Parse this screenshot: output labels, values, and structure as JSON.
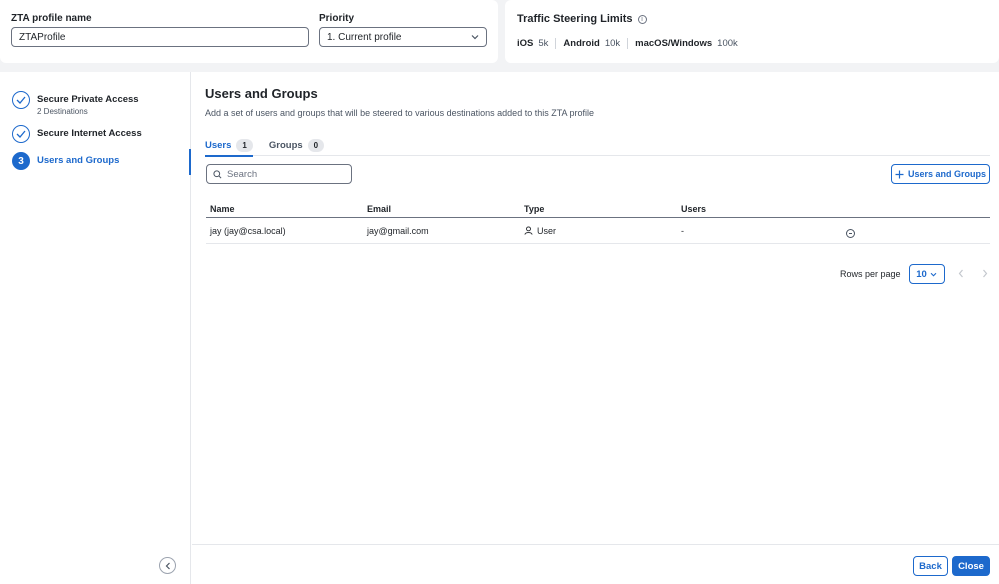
{
  "profile": {
    "name_label": "ZTA profile name",
    "name_value": "ZTAProfile",
    "priority_label": "Priority",
    "priority_value": "1. Current profile"
  },
  "traffic_limits": {
    "title": "Traffic Steering Limits",
    "items": [
      {
        "platform": "iOS",
        "value": "5k"
      },
      {
        "platform": "Android",
        "value": "10k"
      },
      {
        "platform": "macOS/Windows",
        "value": "100k"
      }
    ]
  },
  "steps": [
    {
      "title": "Secure Private Access",
      "subtitle": "2 Destinations",
      "state": "done"
    },
    {
      "title": "Secure Internet Access",
      "subtitle": "",
      "state": "done"
    },
    {
      "title": "Users and Groups",
      "subtitle": "",
      "state": "active",
      "number": "3"
    }
  ],
  "content": {
    "title": "Users and Groups",
    "description": "Add a set of users and groups that will be steered to various destinations added to this ZTA profile",
    "tabs": [
      {
        "label": "Users",
        "count": "1"
      },
      {
        "label": "Groups",
        "count": "0"
      }
    ],
    "search_placeholder": "Search",
    "add_button": "Users and Groups"
  },
  "table": {
    "headers": [
      "Name",
      "Email",
      "Type",
      "Users"
    ],
    "rows": [
      {
        "name": "jay (jay@csa.local)",
        "email": "jay@gmail.com",
        "type": "User",
        "users": "-"
      }
    ]
  },
  "pagination": {
    "rows_label": "Rows per page",
    "rows_value": "10"
  },
  "footer": {
    "back": "Back",
    "close": "Close"
  },
  "colors": {
    "accent": "#1d69cc"
  }
}
